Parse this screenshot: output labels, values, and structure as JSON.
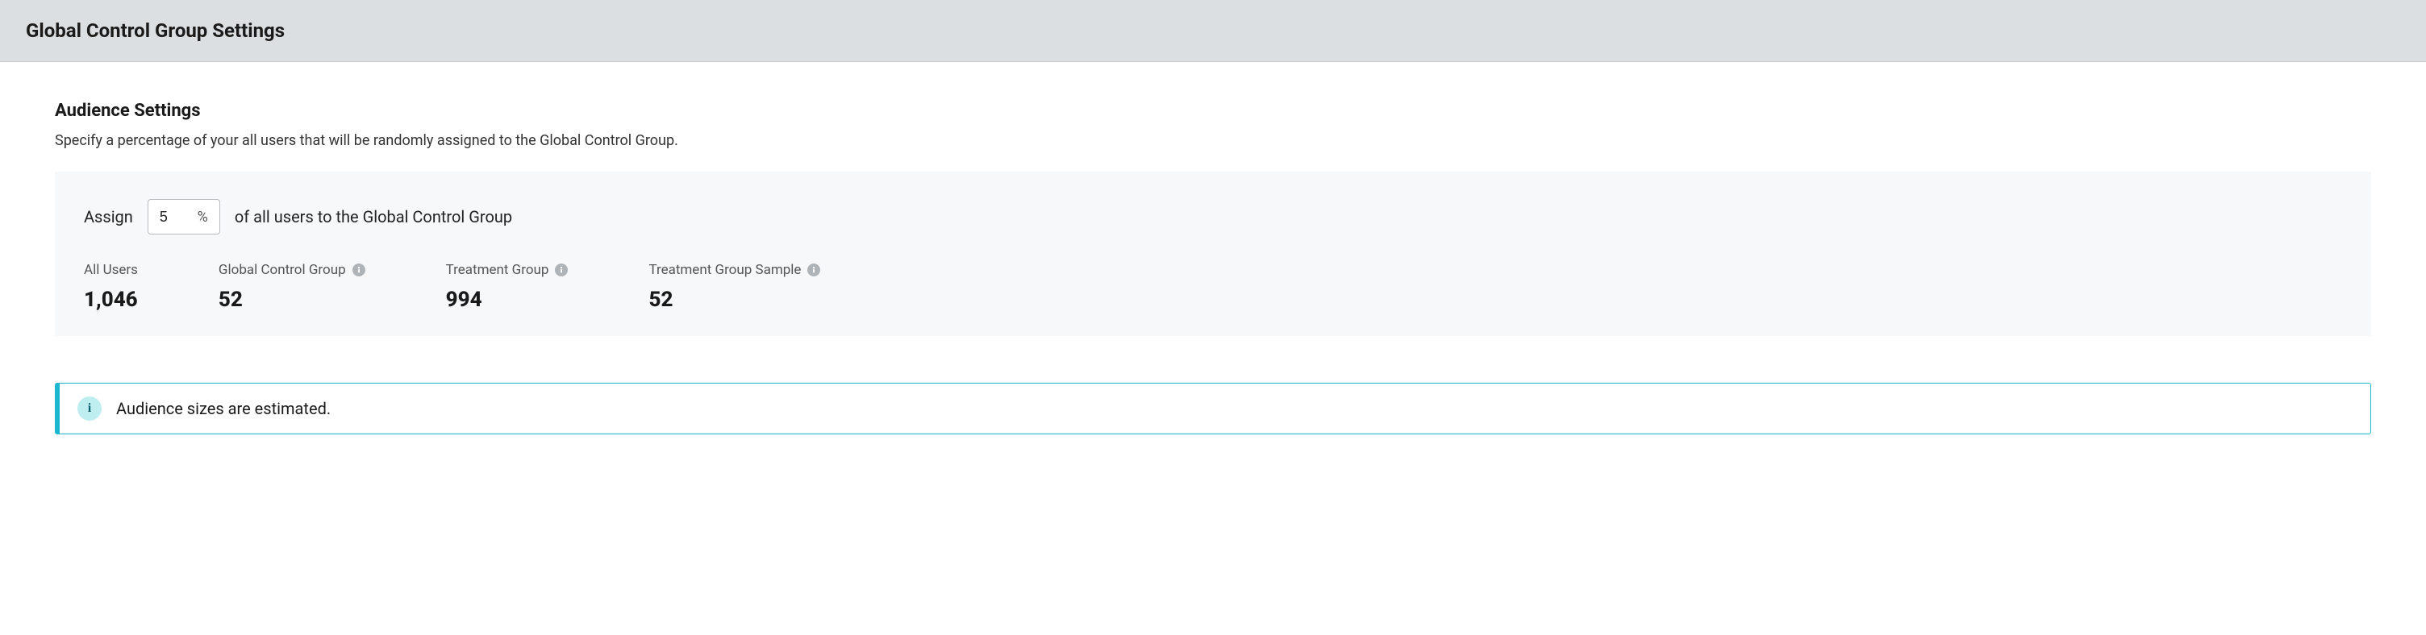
{
  "header": {
    "title": "Global Control Group Settings"
  },
  "section": {
    "title": "Audience Settings",
    "description": "Specify a percentage of your all users that will be randomly assigned to the Global Control Group."
  },
  "assign": {
    "prefix": "Assign",
    "value": "5",
    "percent_sign": "%",
    "suffix": "of all users to the Global Control Group"
  },
  "stats": {
    "all_users": {
      "label": "All Users",
      "value": "1,046"
    },
    "global_control_group": {
      "label": "Global Control Group",
      "value": "52"
    },
    "treatment_group": {
      "label": "Treatment Group",
      "value": "994"
    },
    "treatment_group_sample": {
      "label": "Treatment Group Sample",
      "value": "52"
    }
  },
  "alert": {
    "text": "Audience sizes are estimated."
  }
}
